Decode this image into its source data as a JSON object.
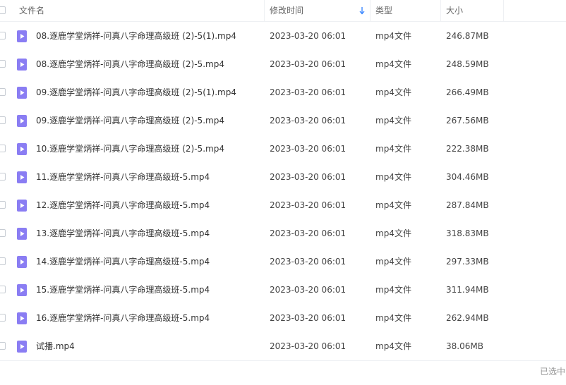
{
  "columns": {
    "name": "文件名",
    "modified": "修改时间",
    "type": "类型",
    "size": "大小"
  },
  "sort": {
    "column": "modified",
    "direction": "desc",
    "icon": "arrow-down-icon"
  },
  "colors": {
    "accent": "#2f80ff",
    "file_icon": "#8a7df3",
    "text": "#333333",
    "header_text": "#666666"
  },
  "files": [
    {
      "name": "08.逐鹿学堂炳祥-问真八字命理高级班 (2)-5(1).mp4",
      "modified": "2023-03-20 06:01",
      "type": "mp4文件",
      "size": "246.87MB"
    },
    {
      "name": "08.逐鹿学堂炳祥-问真八字命理高级班 (2)-5.mp4",
      "modified": "2023-03-20 06:01",
      "type": "mp4文件",
      "size": "248.59MB"
    },
    {
      "name": "09.逐鹿学堂炳祥-问真八字命理高级班 (2)-5(1).mp4",
      "modified": "2023-03-20 06:01",
      "type": "mp4文件",
      "size": "266.49MB"
    },
    {
      "name": "09.逐鹿学堂炳祥-问真八字命理高级班 (2)-5.mp4",
      "modified": "2023-03-20 06:01",
      "type": "mp4文件",
      "size": "267.56MB"
    },
    {
      "name": "10.逐鹿学堂炳祥-问真八字命理高级班 (2)-5.mp4",
      "modified": "2023-03-20 06:01",
      "type": "mp4文件",
      "size": "222.38MB"
    },
    {
      "name": "11.逐鹿学堂炳祥-问真八字命理高级班-5.mp4",
      "modified": "2023-03-20 06:01",
      "type": "mp4文件",
      "size": "304.46MB"
    },
    {
      "name": "12.逐鹿学堂炳祥-问真八字命理高级班-5.mp4",
      "modified": "2023-03-20 06:01",
      "type": "mp4文件",
      "size": "287.84MB"
    },
    {
      "name": "13.逐鹿学堂炳祥-问真八字命理高级班-5.mp4",
      "modified": "2023-03-20 06:01",
      "type": "mp4文件",
      "size": "318.83MB"
    },
    {
      "name": "14.逐鹿学堂炳祥-问真八字命理高级班-5.mp4",
      "modified": "2023-03-20 06:01",
      "type": "mp4文件",
      "size": "297.33MB"
    },
    {
      "name": "15.逐鹿学堂炳祥-问真八字命理高级班-5.mp4",
      "modified": "2023-03-20 06:01",
      "type": "mp4文件",
      "size": "311.94MB"
    },
    {
      "name": "16.逐鹿学堂炳祥-问真八字命理高级班-5.mp4",
      "modified": "2023-03-20 06:01",
      "type": "mp4文件",
      "size": "262.94MB"
    },
    {
      "name": "试播.mp4",
      "modified": "2023-03-20 06:01",
      "type": "mp4文件",
      "size": "38.06MB"
    }
  ],
  "status": {
    "text": "已选中"
  }
}
